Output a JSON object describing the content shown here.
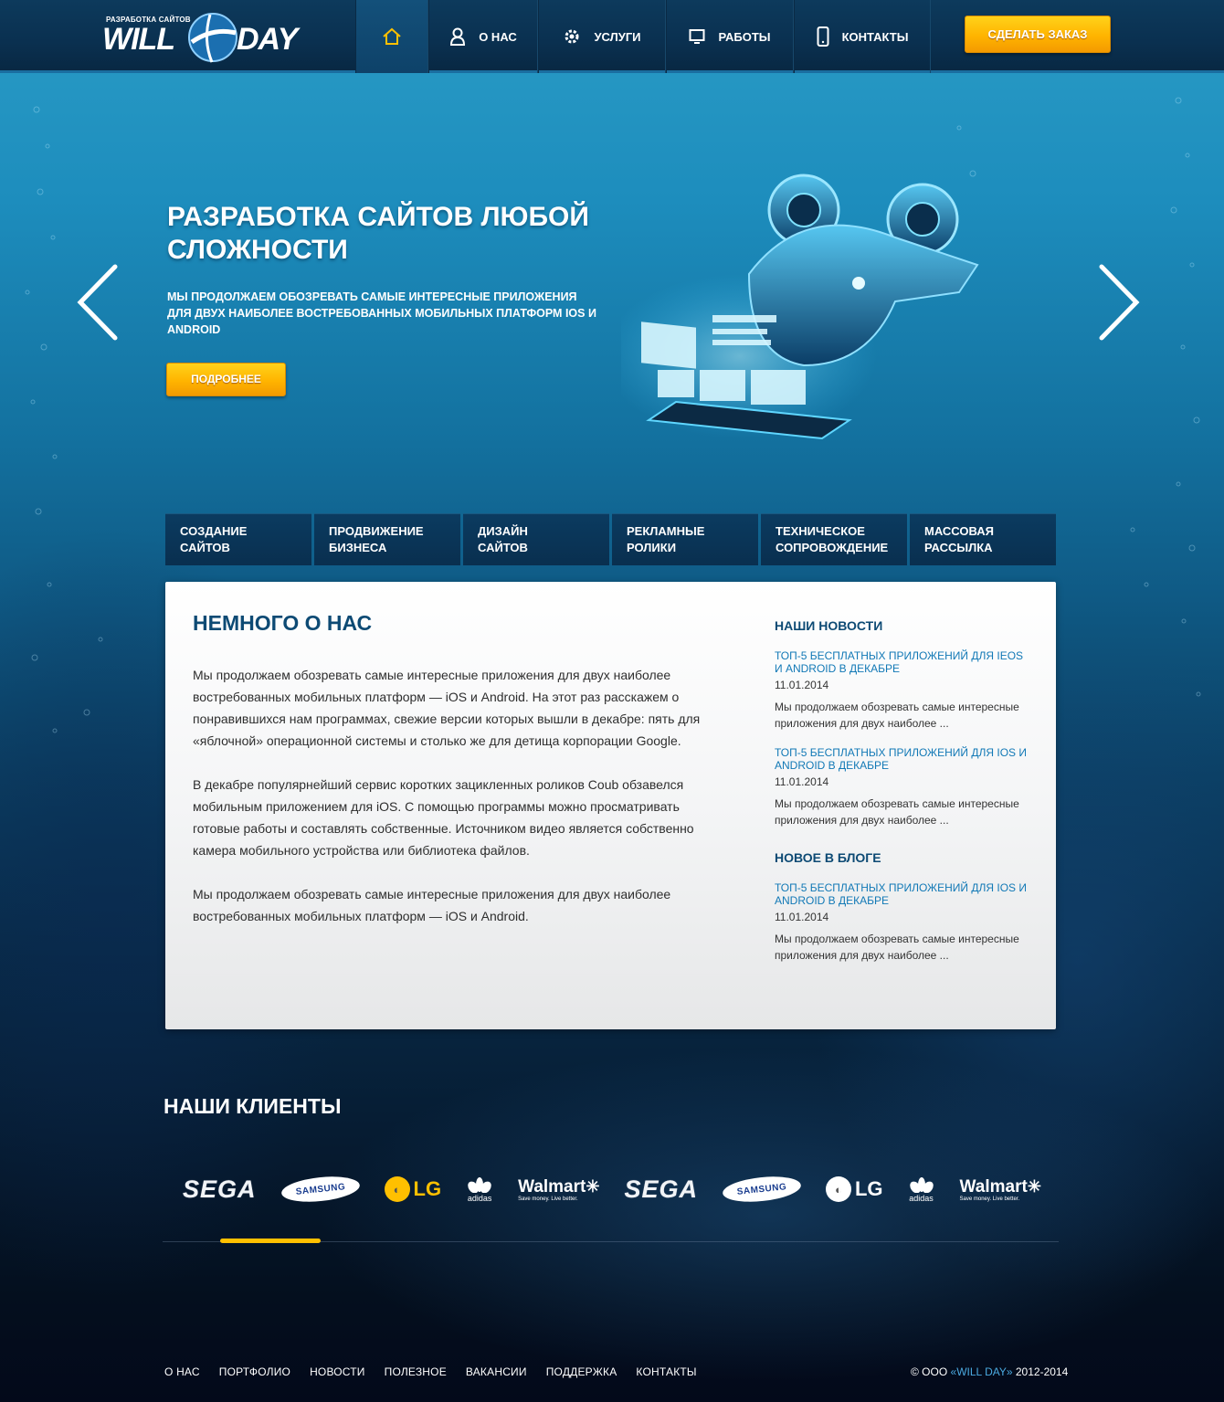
{
  "header": {
    "logo": {
      "tagline": "РАЗРАБОТКА САЙТОВ",
      "word1": "WILL",
      "word2": "DAY"
    },
    "nav": [
      {
        "icon": "home-icon",
        "label": ""
      },
      {
        "icon": "user-icon",
        "label": "О НАС"
      },
      {
        "icon": "gear-icon",
        "label": "УСЛУГИ"
      },
      {
        "icon": "monitor-icon",
        "label": "РАБОТЫ"
      },
      {
        "icon": "phone-icon",
        "label": "КОНТАКТЫ"
      }
    ],
    "order_button": "СДЕЛАТЬ ЗАКАЗ",
    "accent": "#ffb400"
  },
  "hero": {
    "title": "РАЗРАБОТКА САЙТОВ ЛЮБОЙ СЛОЖНОСТИ",
    "text": "МЫ ПРОДОЛЖАЕМ ОБОЗРЕВАТЬ САМЫЕ ИНТЕРЕСНЫЕ ПРИЛОЖЕНИЯ ДЛЯ ДВУХ НАИБОЛЕЕ ВОСТРЕБОВАННЫХ МОБИЛЬНЫХ ПЛАТФОРМ IOS И ANDROID",
    "button": "ПОДРОБНЕЕ",
    "prev_icon": "chevron-left-icon",
    "next_icon": "chevron-right-icon"
  },
  "services": [
    {
      "line1": "СОЗДАНИЕ",
      "line2": "САЙТОВ"
    },
    {
      "line1": "ПРОДВИЖЕНИЕ",
      "line2": "БИЗНЕСА"
    },
    {
      "line1": "ДИЗАЙН",
      "line2": "САЙТОВ"
    },
    {
      "line1": "РЕКЛАМНЫЕ",
      "line2": "РОЛИКИ"
    },
    {
      "line1": "ТЕХНИЧЕСКОЕ",
      "line2": "СОПРОВОЖДЕНИЕ"
    },
    {
      "line1": "МАССОВАЯ",
      "line2": "РАССЫЛКА"
    }
  ],
  "about": {
    "title": "НЕМНОГО О НАС",
    "paragraphs": [
      "Мы продолжаем обозревать самые интересные приложения для двух наиболее востребованных мобильных платформ — iOS и Android. На этот раз расскажем о понравившихся нам программах, свежие версии которых вышли в декабре: пять для «яблочной» операционной системы и столько же для детища корпорации Google.",
      "В декабре популярнейший сервис коротких зацикленных роликов Coub обзавелся мобильным приложением для iOS. С помощью программы можно просматривать готовые работы и составлять собственные. Источником видео является собственно камера мобильного устройства или библиотека файлов.",
      "Мы продолжаем обозревать самые интересные приложения для двух наиболее востребованных мобильных платформ — iOS и Android."
    ]
  },
  "news": {
    "title": "НАШИ НОВОСТИ",
    "items": [
      {
        "title": "ТОП-5 БЕСПЛАТНЫХ ПРИЛОЖЕНИЙ ДЛЯ IEOS И ANDROID В ДЕКАБРЕ",
        "date": "11.01.2014",
        "excerpt": "Мы продолжаем обозревать самые интересные приложения для двух наиболее ..."
      },
      {
        "title": "ТОП-5 БЕСПЛАТНЫХ ПРИЛОЖЕНИЙ ДЛЯ IOS И ANDROID В ДЕКАБРЕ",
        "date": "11.01.2014",
        "excerpt": "Мы продолжаем обозревать самые интересные приложения для двух наиболее ..."
      }
    ]
  },
  "blog": {
    "title": "НОВОЕ В БЛОГЕ",
    "items": [
      {
        "title": "ТОП-5 БЕСПЛАТНЫХ ПРИЛОЖЕНИЙ ДЛЯ IOS И ANDROID В ДЕКАБРЕ",
        "date": "11.01.2014",
        "excerpt": "Мы продолжаем обозревать самые интересные приложения для двух наиболее ..."
      }
    ]
  },
  "clients": {
    "title": "НАШИ КЛИЕНТЫ",
    "logos": [
      {
        "name": "SEGA"
      },
      {
        "name": "SAMSUNG"
      },
      {
        "name": "LG",
        "color": "#ffc000"
      },
      {
        "name": "adidas"
      },
      {
        "name": "Walmart",
        "slogan": "Save money. Live better."
      },
      {
        "name": "SEGA"
      },
      {
        "name": "SAMSUNG"
      },
      {
        "name": "LG",
        "color": "#ffffff"
      },
      {
        "name": "adidas"
      },
      {
        "name": "Walmart",
        "slogan": "Save money. Live better."
      }
    ]
  },
  "footer": {
    "links": [
      "О НАС",
      "ПОРТФОЛИО",
      "НОВОСТИ",
      "ПОЛЕЗНОЕ",
      "ВАКАНСИИ",
      "ПОДДЕРЖКА",
      "КОНТАКТЫ"
    ],
    "copyright_prefix": "© ООО ",
    "copyright_brand": "«WILL DAY»",
    "copyright_years": " 2012-2014"
  }
}
